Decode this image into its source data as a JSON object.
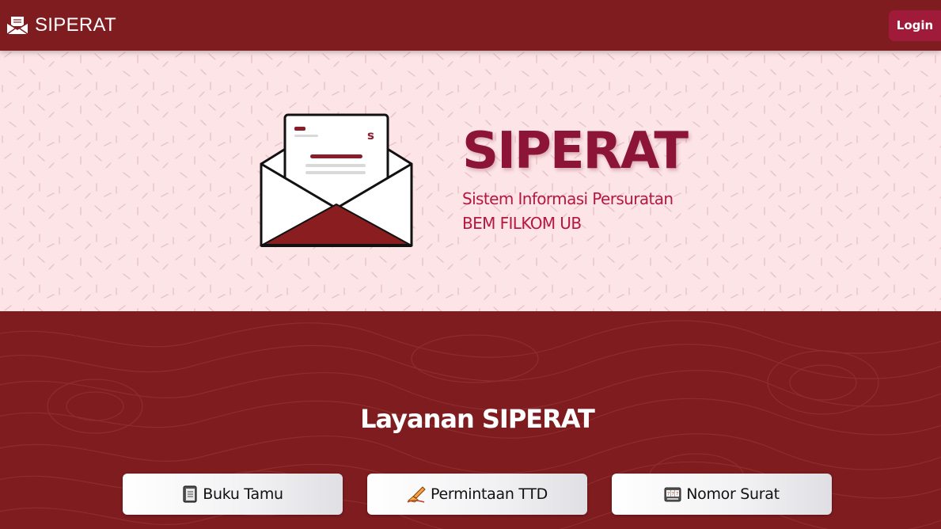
{
  "navbar": {
    "brand": "SIPERAT",
    "brand_icon": "envelope-icon",
    "login_label": "Login"
  },
  "hero": {
    "illustration": "open-envelope-letter-icon",
    "title": "SIPERAT",
    "subtitle_line1": "Sistem Informasi Persuratan",
    "subtitle_line2": "BEM FILKOM UB"
  },
  "services": {
    "title": "Layanan SIPERAT",
    "items": [
      {
        "label": "Buku Tamu",
        "icon": "notebook-icon"
      },
      {
        "label": "Permintaan TTD",
        "icon": "writing-hand-icon"
      },
      {
        "label": "Nomor Surat",
        "icon": "slot-machine-icon"
      }
    ]
  },
  "colors": {
    "primary": "#7e1c1f",
    "accent": "#a01a3a",
    "hero_bg": "#fde4e6",
    "title": "#8c1437"
  }
}
